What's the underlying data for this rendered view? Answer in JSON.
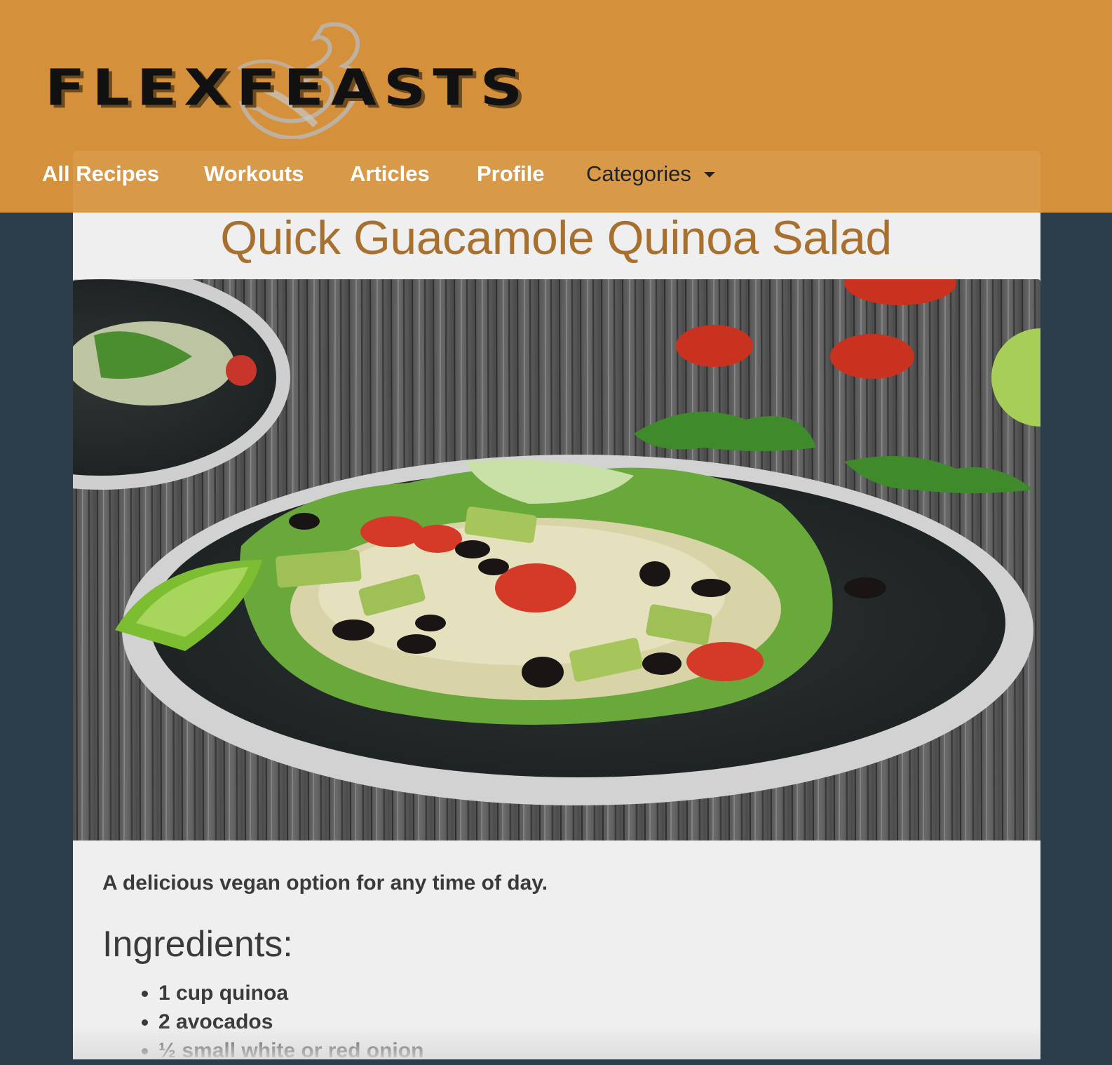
{
  "brand": {
    "name": "FLEXFEASTS",
    "logo_icon": "flexed-arm-icon"
  },
  "nav": {
    "links": [
      {
        "label": "All Recipes"
      },
      {
        "label": "Workouts"
      },
      {
        "label": "Articles"
      },
      {
        "label": "Profile"
      }
    ],
    "dropdown": {
      "label": "Categories",
      "icon": "caret-down-icon"
    }
  },
  "recipe": {
    "title": "Quick Guacamole Quinoa Salad",
    "description": "A delicious vegan option for any time of day.",
    "ingredients_heading": "Ingredients:",
    "ingredients": [
      "1 cup quinoa",
      "2 avocados",
      "½ small white or red onion"
    ]
  },
  "colors": {
    "header_bg": "#d4903a",
    "page_bg": "#2c3e4c",
    "title": "#a8702e",
    "card_bg": "#efefef"
  }
}
